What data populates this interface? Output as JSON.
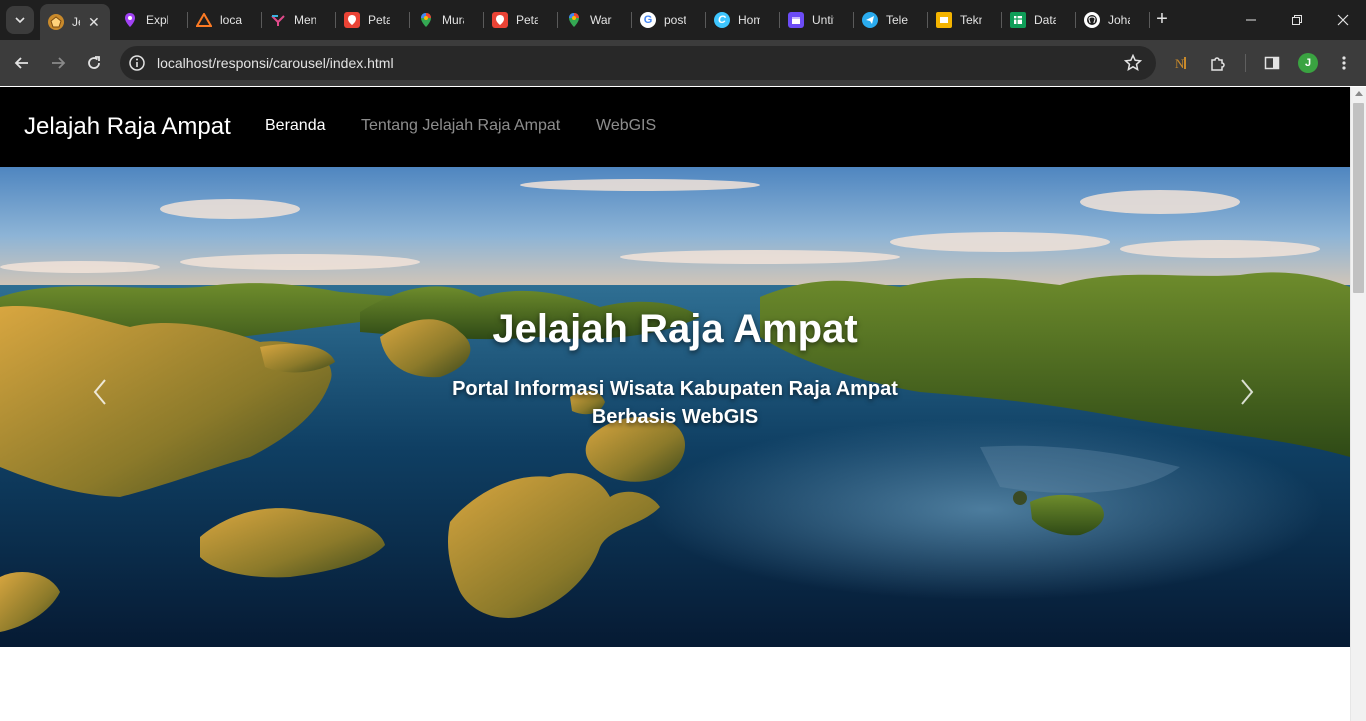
{
  "browser": {
    "tabs": [
      {
        "title": "Jelajah Raja Ampat",
        "icon": "raja-ampat-favicon",
        "color": "#c98a2b",
        "active": true
      },
      {
        "title": "Explore",
        "icon": "map-pin-purple-icon",
        "color": "#a142f4"
      },
      {
        "title": "localhost",
        "icon": "xampp-icon",
        "color": "#fb7a24"
      },
      {
        "title": "Mengenal",
        "icon": "colorful-logo-icon",
        "color": "#e04a8b"
      },
      {
        "title": "Peta",
        "icon": "red-pin-icon",
        "color": "#ea4335"
      },
      {
        "title": "Murah",
        "icon": "google-maps-icon",
        "color": "#34a853"
      },
      {
        "title": "Peta",
        "icon": "red-pin-icon",
        "color": "#ea4335"
      },
      {
        "title": "Warung",
        "icon": "google-maps-icon",
        "color": "#34a853"
      },
      {
        "title": "postgis",
        "icon": "google-g-icon",
        "color": "#4285f4"
      },
      {
        "title": "Home",
        "icon": "canva-c-icon",
        "color": "#7d2ae8"
      },
      {
        "title": "Untitled",
        "icon": "calendar-app-icon",
        "color": "#6c4cf6"
      },
      {
        "title": "Telegram",
        "icon": "telegram-icon",
        "color": "#2aabee"
      },
      {
        "title": "Teknik",
        "icon": "google-slides-icon",
        "color": "#f4b400"
      },
      {
        "title": "Data",
        "icon": "google-sheets-icon",
        "color": "#0f9d58"
      },
      {
        "title": "Johan",
        "icon": "github-icon",
        "color": "#ffffff"
      }
    ],
    "url": "localhost/responsi/carousel/index.html",
    "profile_initial": "J"
  },
  "site": {
    "brand": "Jelajah Raja Ampat",
    "nav": [
      {
        "label": "Beranda",
        "active": true
      },
      {
        "label": "Tentang Jelajah Raja Ampat",
        "active": false
      },
      {
        "label": "WebGIS",
        "active": false
      }
    ],
    "carousel": {
      "title": "Jelajah Raja Ampat",
      "subtitle": "Portal Informasi Wisata Kabupaten Raja Ampat Berbasis WebGIS",
      "prev_icon": "chevron-left-icon",
      "next_icon": "chevron-right-icon"
    }
  }
}
